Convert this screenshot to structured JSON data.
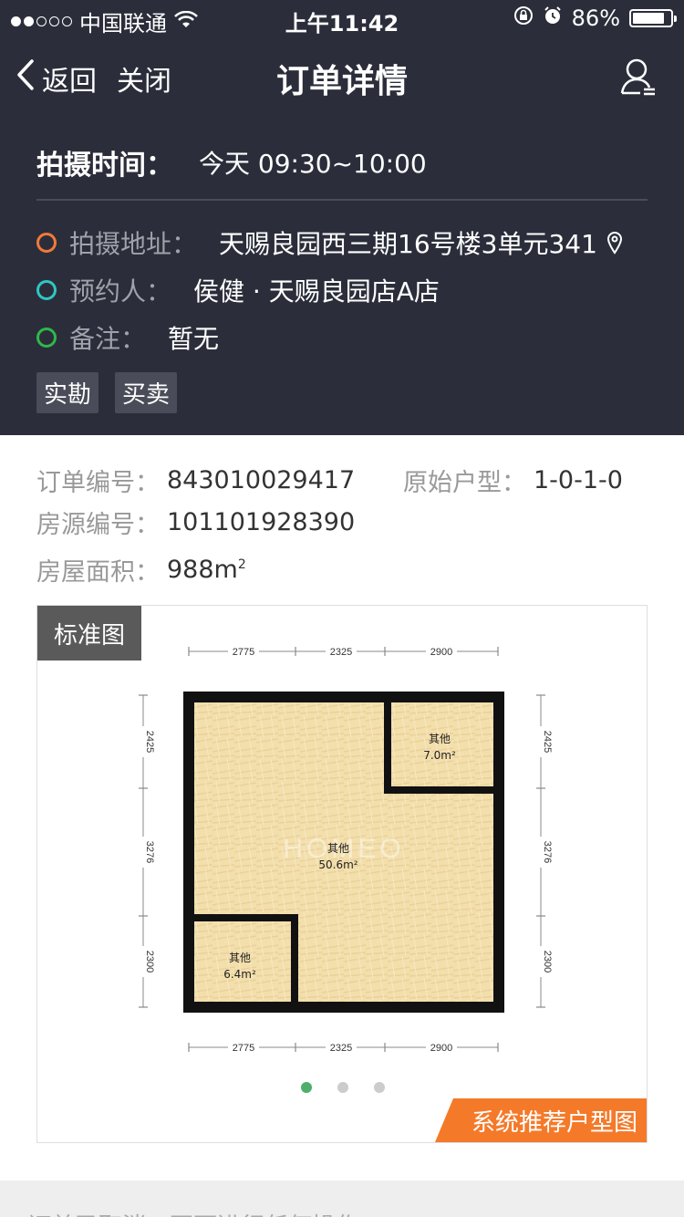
{
  "status_bar": {
    "carrier": "中国联通",
    "time": "上午11:42",
    "battery": "86%",
    "battery_level": 0.86
  },
  "nav": {
    "back_label": "返回",
    "close_label": "关闭",
    "title": "订单详情"
  },
  "header": {
    "shoot_time_label": "拍摄时间：",
    "shoot_time_value": "今天 09:30~10:00",
    "address_label": "拍摄地址：",
    "address_value": "天赐良园西三期16号楼3单元341",
    "booker_label": "预约人：",
    "booker_value": "侯健 · 天赐良园店A店",
    "note_label": "备注：",
    "note_value": "暂无",
    "tags": [
      "实勘",
      "买卖"
    ],
    "colors": {
      "address": "#f07a3a",
      "booker": "#2fc7c2",
      "note": "#2fb84a"
    }
  },
  "order": {
    "order_no_label": "订单编号：",
    "order_no_value": "843010029417",
    "orig_type_label": "原始户型：",
    "orig_type_value": "1-0-1-0",
    "house_no_label": "房源编号：",
    "house_no_value": "101101928390",
    "area_label": "房屋面积：",
    "area_value": "988m",
    "area_unit_sup": "2"
  },
  "plan": {
    "badge": "标准图",
    "watermark": "HOMEO",
    "top_dims": [
      "2775",
      "2325",
      "2900"
    ],
    "bottom_dims": [
      "2775",
      "2325",
      "2900"
    ],
    "left_dims": [
      "2425",
      "3276",
      "2300"
    ],
    "right_dims": [
      "2425",
      "3276",
      "2300"
    ],
    "rooms": [
      {
        "name": "其他",
        "area": "50.6m²"
      },
      {
        "name": "其他",
        "area": "7.0m²"
      },
      {
        "name": "其他",
        "area": "6.4m²"
      }
    ],
    "pager_count": 3,
    "pager_active": 0,
    "recommend_label": "系统推荐户型图"
  },
  "bottom": {
    "text": "订单已取消，不可进行任何操作"
  }
}
